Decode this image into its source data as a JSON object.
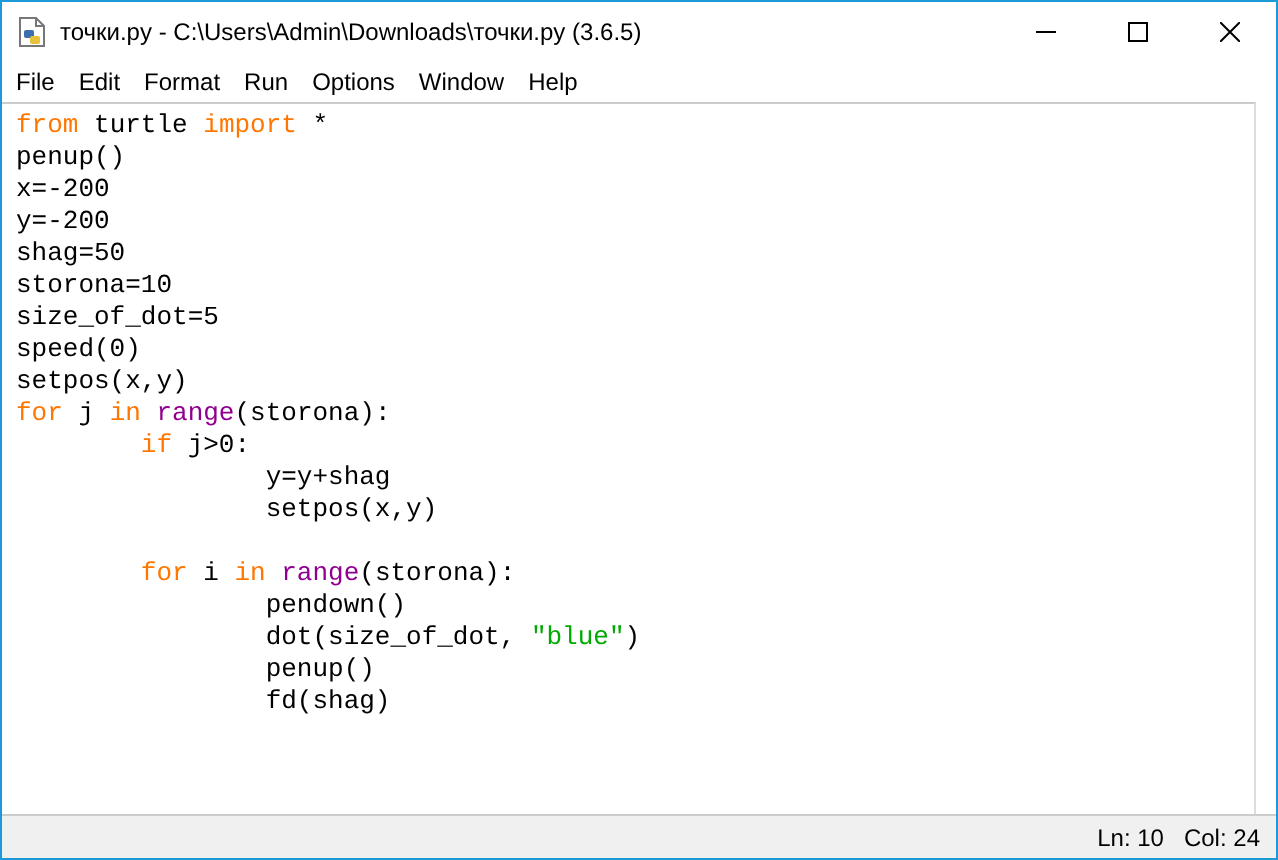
{
  "window": {
    "title": "точки.py - C:\\Users\\Admin\\Downloads\\точки.py (3.6.5)"
  },
  "menu": [
    "File",
    "Edit",
    "Format",
    "Run",
    "Options",
    "Window",
    "Help"
  ],
  "editor": {
    "lines": [
      {
        "tokens": [
          {
            "kind": "keyword",
            "text": "from"
          },
          {
            "kind": "plain",
            "text": " turtle "
          },
          {
            "kind": "keyword",
            "text": "import"
          },
          {
            "kind": "plain",
            "text": " *"
          }
        ]
      },
      {
        "tokens": [
          {
            "kind": "plain",
            "text": "penup()"
          }
        ]
      },
      {
        "tokens": [
          {
            "kind": "plain",
            "text": "x=-200"
          }
        ]
      },
      {
        "tokens": [
          {
            "kind": "plain",
            "text": "y=-200"
          }
        ]
      },
      {
        "tokens": [
          {
            "kind": "plain",
            "text": "shag=50"
          }
        ]
      },
      {
        "tokens": [
          {
            "kind": "plain",
            "text": "storona=10"
          }
        ]
      },
      {
        "tokens": [
          {
            "kind": "plain",
            "text": "size_of_dot=5"
          }
        ]
      },
      {
        "tokens": [
          {
            "kind": "plain",
            "text": "speed(0)"
          }
        ]
      },
      {
        "tokens": [
          {
            "kind": "plain",
            "text": "setpos(x,y)"
          }
        ]
      },
      {
        "tokens": [
          {
            "kind": "keyword",
            "text": "for"
          },
          {
            "kind": "plain",
            "text": " j "
          },
          {
            "kind": "keyword",
            "text": "in "
          },
          {
            "kind": "builtin",
            "text": "range"
          },
          {
            "kind": "plain",
            "text": "(storona):"
          }
        ],
        "children": [
          {
            "tokens": [
              {
                "kind": "keyword",
                "text": "if"
              },
              {
                "kind": "plain",
                "text": " j>0:"
              }
            ],
            "children": [
              {
                "tokens": [
                  {
                    "kind": "plain",
                    "text": "y=y+shag"
                  }
                ]
              },
              {
                "tokens": [
                  {
                    "kind": "plain",
                    "text": "setpos(x,y)"
                  }
                ]
              }
            ]
          },
          {
            "kind": "blank"
          },
          {
            "tokens": [
              {
                "kind": "keyword",
                "text": "for"
              },
              {
                "kind": "plain",
                "text": " i "
              },
              {
                "kind": "keyword",
                "text": "in "
              },
              {
                "kind": "builtin",
                "text": "range"
              },
              {
                "kind": "plain",
                "text": "(storona):"
              }
            ],
            "children": [
              {
                "tokens": [
                  {
                    "kind": "plain",
                    "text": "pendown()"
                  }
                ]
              },
              {
                "tokens": [
                  {
                    "kind": "plain",
                    "text": "dot(size_of_dot, "
                  },
                  {
                    "kind": "string",
                    "text": "\"blue\""
                  },
                  {
                    "kind": "plain",
                    "text": ")"
                  }
                ]
              },
              {
                "tokens": [
                  {
                    "kind": "plain",
                    "text": "penup()"
                  }
                ]
              },
              {
                "tokens": [
                  {
                    "kind": "plain",
                    "text": "fd(shag)"
                  }
                ]
              }
            ]
          }
        ]
      }
    ]
  },
  "status_bar": {
    "line": "Ln: 10",
    "column": "Col: 24"
  }
}
